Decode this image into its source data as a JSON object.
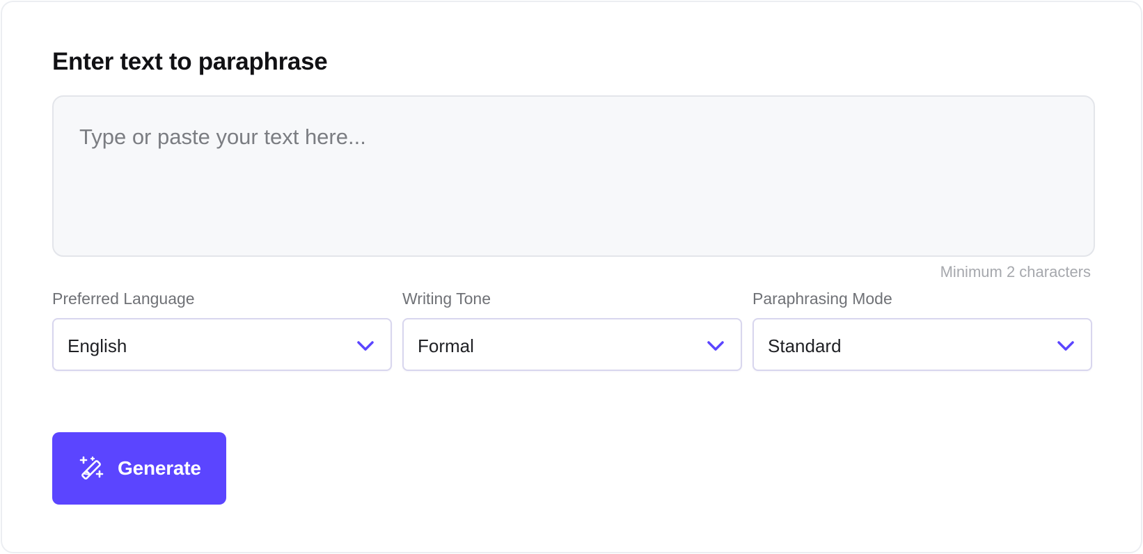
{
  "form": {
    "heading": "Enter text to paraphrase",
    "input": {
      "placeholder": "Type or paste your text here...",
      "value": ""
    },
    "hint": "Minimum 2 characters",
    "fields": [
      {
        "label": "Preferred Language",
        "value": "English",
        "icon": "chevron-down-icon"
      },
      {
        "label": "Writing Tone",
        "value": "Formal",
        "icon": "chevron-down-icon"
      },
      {
        "label": "Paraphrasing Mode",
        "value": "Standard",
        "icon": "chevron-down-icon"
      }
    ],
    "generate_button": {
      "label": "Generate",
      "icon": "magic-wand-icon"
    }
  },
  "colors": {
    "accent": "#5b45ff",
    "textarea_bg": "#f7f8fa",
    "border": "#d8d6ee"
  }
}
